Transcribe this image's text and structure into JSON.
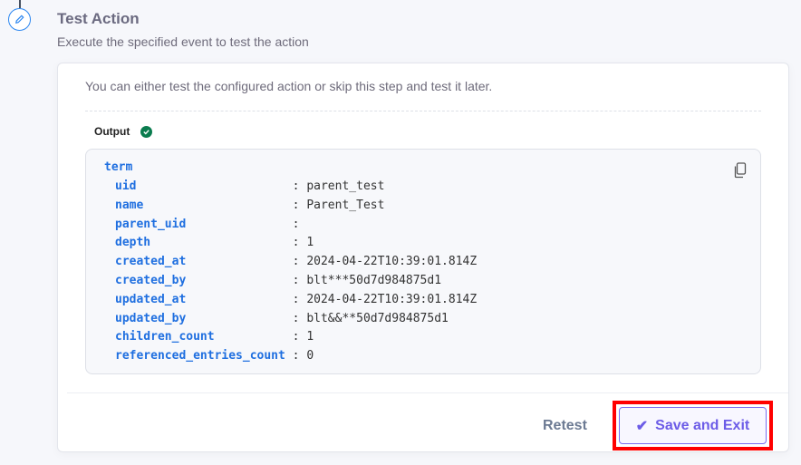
{
  "step": {
    "title": "Test Action",
    "subtitle": "Execute the specified event to test the action",
    "icon": "pencil-icon"
  },
  "card": {
    "intro": "You can either test the configured action or skip this step and test it later.",
    "output_label": "Output",
    "status": "success"
  },
  "output": {
    "root": "term",
    "rows": [
      {
        "key": "uid",
        "value": "parent_test"
      },
      {
        "key": "name",
        "value": "Parent_Test"
      },
      {
        "key": "parent_uid",
        "value": ""
      },
      {
        "key": "depth",
        "value": "1"
      },
      {
        "key": "created_at",
        "value": "2024-04-22T10:39:01.814Z"
      },
      {
        "key": "created_by",
        "value": "blt***50d7d984875d1"
      },
      {
        "key": "updated_at",
        "value": "2024-04-22T10:39:01.814Z"
      },
      {
        "key": "updated_by",
        "value": "blt&&**50d7d984875d1"
      },
      {
        "key": "children_count",
        "value": "1"
      },
      {
        "key": "referenced_entries_count",
        "value": "0"
      }
    ]
  },
  "footer": {
    "retest": "Retest",
    "save": "Save and Exit"
  },
  "colors": {
    "accent": "#6c5ce7",
    "key": "#1f6fe0",
    "success": "#0a7c4e",
    "highlight": "#ff0000"
  }
}
